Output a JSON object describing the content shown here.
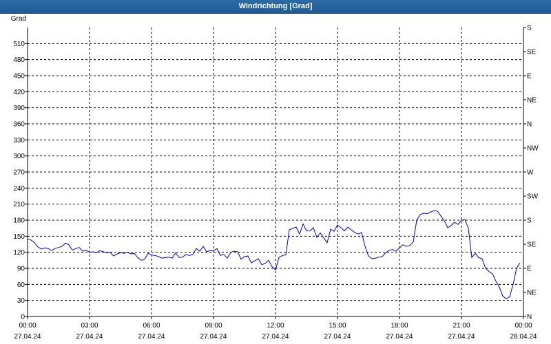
{
  "window": {
    "title": "Windrichtung [Grad]"
  },
  "chart_data": {
    "type": "line",
    "title": "Windrichtung [Grad]",
    "ylabel": "Grad",
    "ylim": [
      0,
      540
    ],
    "y_ticks": [
      0,
      30,
      60,
      90,
      120,
      150,
      180,
      210,
      240,
      270,
      300,
      330,
      360,
      390,
      420,
      450,
      480,
      510
    ],
    "y2_ticks": [
      {
        "value": 0,
        "label": "N"
      },
      {
        "value": 45,
        "label": "NE"
      },
      {
        "value": 90,
        "label": "E"
      },
      {
        "value": 135,
        "label": "SE"
      },
      {
        "value": 180,
        "label": "S"
      },
      {
        "value": 225,
        "label": "SW"
      },
      {
        "value": 270,
        "label": "W"
      },
      {
        "value": 315,
        "label": "NW"
      },
      {
        "value": 360,
        "label": "N"
      },
      {
        "value": 405,
        "label": "NE"
      },
      {
        "value": 450,
        "label": "E"
      },
      {
        "value": 495,
        "label": "SE"
      },
      {
        "value": 540,
        "label": "S"
      }
    ],
    "xlim": [
      "27.04.24 00:00",
      "28.04.24 00:00"
    ],
    "x_ticks": [
      {
        "time": "00:00",
        "date": "27.04.24"
      },
      {
        "time": "03:00",
        "date": "27.04.24"
      },
      {
        "time": "06:00",
        "date": "27.04.24"
      },
      {
        "time": "09:00",
        "date": "27.04.24"
      },
      {
        "time": "12:00",
        "date": "27.04.24"
      },
      {
        "time": "15:00",
        "date": "27.04.24"
      },
      {
        "time": "18:00",
        "date": "27.04.24"
      },
      {
        "time": "21:00",
        "date": "27.04.24"
      },
      {
        "time": "00:00",
        "date": "28.04.24"
      }
    ],
    "grid": true,
    "line_color": "#0000cc",
    "series": [
      {
        "points": [
          [
            "27.04.24 00:00",
            145
          ],
          [
            "27.04.24 00:10",
            143
          ],
          [
            "27.04.24 00:20",
            138
          ],
          [
            "27.04.24 00:30",
            130
          ],
          [
            "27.04.24 00:40",
            126
          ],
          [
            "27.04.24 00:50",
            128
          ],
          [
            "27.04.24 01:00",
            127
          ],
          [
            "27.04.24 01:10",
            123
          ],
          [
            "27.04.24 01:20",
            127
          ],
          [
            "27.04.24 01:30",
            129
          ],
          [
            "27.04.24 01:40",
            131
          ],
          [
            "27.04.24 01:50",
            137
          ],
          [
            "27.04.24 02:00",
            134
          ],
          [
            "27.04.24 02:10",
            124
          ],
          [
            "27.04.24 02:20",
            127
          ],
          [
            "27.04.24 02:30",
            129
          ],
          [
            "27.04.24 02:40",
            122
          ],
          [
            "27.04.24 02:50",
            124
          ],
          [
            "27.04.24 03:00",
            120
          ],
          [
            "27.04.24 03:10",
            121
          ],
          [
            "27.04.24 03:20",
            119
          ],
          [
            "27.04.24 03:30",
            123
          ],
          [
            "27.04.24 03:40",
            121
          ],
          [
            "27.04.24 03:50",
            119
          ],
          [
            "27.04.24 04:00",
            120
          ],
          [
            "27.04.24 04:10",
            113
          ],
          [
            "27.04.24 04:20",
            117
          ],
          [
            "27.04.24 04:30",
            119
          ],
          [
            "27.04.24 04:40",
            118
          ],
          [
            "27.04.24 04:50",
            120
          ],
          [
            "27.04.24 05:00",
            117
          ],
          [
            "27.04.24 05:10",
            118
          ],
          [
            "27.04.24 05:20",
            110
          ],
          [
            "27.04.24 05:30",
            105
          ],
          [
            "27.04.24 05:40",
            107
          ],
          [
            "27.04.24 05:50",
            118
          ],
          [
            "27.04.24 06:00",
            115
          ],
          [
            "27.04.24 06:10",
            114
          ],
          [
            "27.04.24 06:20",
            112
          ],
          [
            "27.04.24 06:30",
            109
          ],
          [
            "27.04.24 06:40",
            110
          ],
          [
            "27.04.24 06:50",
            111
          ],
          [
            "27.04.24 07:00",
            109
          ],
          [
            "27.04.24 07:10",
            119
          ],
          [
            "27.04.24 07:20",
            110
          ],
          [
            "27.04.24 07:30",
            111
          ],
          [
            "27.04.24 07:40",
            116
          ],
          [
            "27.04.24 07:50",
            114
          ],
          [
            "27.04.24 08:00",
            116
          ],
          [
            "27.04.24 08:10",
            127
          ],
          [
            "27.04.24 08:20",
            122
          ],
          [
            "27.04.24 08:30",
            131
          ],
          [
            "27.04.24 08:40",
            121
          ],
          [
            "27.04.24 08:50",
            123
          ],
          [
            "27.04.24 09:00",
            123
          ],
          [
            "27.04.24 09:10",
            127
          ],
          [
            "27.04.24 09:20",
            114
          ],
          [
            "27.04.24 09:30",
            116
          ],
          [
            "27.04.24 09:40",
            109
          ],
          [
            "27.04.24 09:50",
            120
          ],
          [
            "27.04.24 10:00",
            122
          ],
          [
            "27.04.24 10:10",
            121
          ],
          [
            "27.04.24 10:20",
            107
          ],
          [
            "27.04.24 10:30",
            112
          ],
          [
            "27.04.24 10:40",
            113
          ],
          [
            "27.04.24 10:50",
            100
          ],
          [
            "27.04.24 11:00",
            104
          ],
          [
            "27.04.24 11:10",
            108
          ],
          [
            "27.04.24 11:20",
            97
          ],
          [
            "27.04.24 11:30",
            99
          ],
          [
            "27.04.24 11:40",
            105
          ],
          [
            "27.04.24 11:50",
            93
          ],
          [
            "27.04.24 12:00",
            87
          ],
          [
            "27.04.24 12:10",
            110
          ],
          [
            "27.04.24 12:20",
            114
          ],
          [
            "27.04.24 12:30",
            115
          ],
          [
            "27.04.24 12:40",
            162
          ],
          [
            "27.04.24 12:50",
            165
          ],
          [
            "27.04.24 13:00",
            167
          ],
          [
            "27.04.24 13:10",
            154
          ],
          [
            "27.04.24 13:20",
            173
          ],
          [
            "27.04.24 13:30",
            160
          ],
          [
            "27.04.24 13:40",
            160
          ],
          [
            "27.04.24 13:50",
            166
          ],
          [
            "27.04.24 14:00",
            148
          ],
          [
            "27.04.24 14:10",
            156
          ],
          [
            "27.04.24 14:20",
            147
          ],
          [
            "27.04.24 14:30",
            138
          ],
          [
            "27.04.24 14:40",
            163
          ],
          [
            "27.04.24 14:50",
            159
          ],
          [
            "27.04.24 15:00",
            171
          ],
          [
            "27.04.24 15:10",
            166
          ],
          [
            "27.04.24 15:20",
            160
          ],
          [
            "27.04.24 15:30",
            167
          ],
          [
            "27.04.24 15:40",
            162
          ],
          [
            "27.04.24 15:50",
            157
          ],
          [
            "27.04.24 16:00",
            154
          ],
          [
            "27.04.24 16:10",
            157
          ],
          [
            "27.04.24 16:20",
            131
          ],
          [
            "27.04.24 16:30",
            113
          ],
          [
            "27.04.24 16:40",
            108
          ],
          [
            "27.04.24 16:50",
            109
          ],
          [
            "27.04.24 17:00",
            111
          ],
          [
            "27.04.24 17:10",
            112
          ],
          [
            "27.04.24 17:20",
            119
          ],
          [
            "27.04.24 17:30",
            124
          ],
          [
            "27.04.24 17:40",
            125
          ],
          [
            "27.04.24 17:50",
            122
          ],
          [
            "27.04.24 18:00",
            128
          ],
          [
            "27.04.24 18:10",
            134
          ],
          [
            "27.04.24 18:20",
            131
          ],
          [
            "27.04.24 18:30",
            133
          ],
          [
            "27.04.24 18:40",
            139
          ],
          [
            "27.04.24 18:50",
            180
          ],
          [
            "27.04.24 19:00",
            190
          ],
          [
            "27.04.24 19:10",
            193
          ],
          [
            "27.04.24 19:20",
            192
          ],
          [
            "27.04.24 19:30",
            195
          ],
          [
            "27.04.24 19:40",
            198
          ],
          [
            "27.04.24 19:50",
            197
          ],
          [
            "27.04.24 20:00",
            188
          ],
          [
            "27.04.24 20:10",
            179
          ],
          [
            "27.04.24 20:20",
            166
          ],
          [
            "27.04.24 20:30",
            170
          ],
          [
            "27.04.24 20:40",
            176
          ],
          [
            "27.04.24 20:50",
            172
          ],
          [
            "27.04.24 21:00",
            180
          ],
          [
            "27.04.24 21:10",
            181
          ],
          [
            "27.04.24 21:20",
            165
          ],
          [
            "27.04.24 21:30",
            110
          ],
          [
            "27.04.24 21:40",
            118
          ],
          [
            "27.04.24 21:50",
            110
          ],
          [
            "27.04.24 22:00",
            108
          ],
          [
            "27.04.24 22:10",
            90
          ],
          [
            "27.04.24 22:20",
            84
          ],
          [
            "27.04.24 22:30",
            80
          ],
          [
            "27.04.24 22:40",
            66
          ],
          [
            "27.04.24 22:50",
            55
          ],
          [
            "27.04.24 23:00",
            38
          ],
          [
            "27.04.24 23:10",
            33
          ],
          [
            "27.04.24 23:20",
            37
          ],
          [
            "27.04.24 23:30",
            60
          ],
          [
            "27.04.24 23:40",
            90
          ],
          [
            "27.04.24 23:50",
            100
          ]
        ]
      }
    ]
  }
}
